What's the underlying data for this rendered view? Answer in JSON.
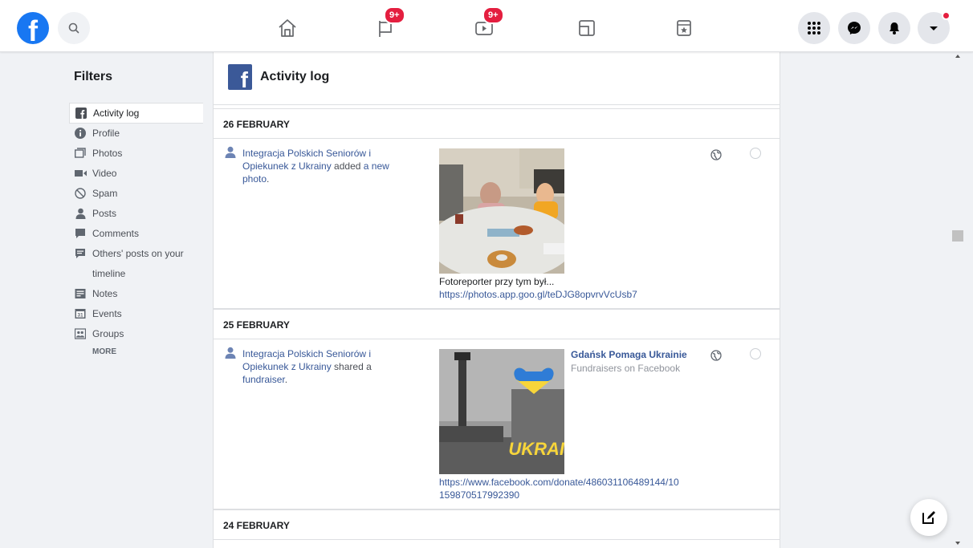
{
  "nav": {
    "logo": "f",
    "watch_badge": "9+",
    "feed_badge": "9+"
  },
  "filters": {
    "title": "Filters",
    "items": [
      {
        "label": "Activity log",
        "icon": "facebook-icon"
      },
      {
        "label": "Profile",
        "icon": "info-icon"
      },
      {
        "label": "Photos",
        "icon": "photos-icon"
      },
      {
        "label": "Video",
        "icon": "video-icon"
      },
      {
        "label": "Spam",
        "icon": "spam-icon"
      },
      {
        "label": "Posts",
        "icon": "person-icon"
      },
      {
        "label": "Comments",
        "icon": "comment-icon"
      },
      {
        "label": "Others' posts on your timeline",
        "icon": "others-posts-icon"
      },
      {
        "label": "Notes",
        "icon": "notes-icon"
      },
      {
        "label": "Events",
        "icon": "events-icon"
      },
      {
        "label": "Groups",
        "icon": "groups-icon"
      }
    ],
    "more": "MORE"
  },
  "main": {
    "header_logo": "f",
    "title": "Activity log",
    "sections": [
      {
        "date": "26 FEBRUARY",
        "entry": {
          "actor": "Integracja Polskich Seniorów i Opiekunek z Ukrainy",
          "verb": " added ",
          "object": "a new photo",
          "end": ".",
          "caption": "Fotoreporter przy tym był...",
          "link": "https://photos.app.goo.gl/teDJG8opvrvVcUsb7"
        }
      },
      {
        "date": "25 FEBRUARY",
        "entry": {
          "actor": "Integracja Polskich Seniorów i Opiekunek z Ukrainy",
          "verb": " shared a ",
          "object": "fundraiser",
          "end": ".",
          "fund_title": "Gdańsk Pomaga Ukrainie",
          "fund_sub": "Fundraisers on Facebook",
          "image_text": "UKRAI",
          "link": "https://www.facebook.com/donate/486031106489144/10159870517992390"
        }
      },
      {
        "date": "24 FEBRUARY"
      }
    ]
  },
  "colors": {
    "brand": "#1877f2",
    "link": "#385898",
    "badge": "#e41e3f"
  }
}
